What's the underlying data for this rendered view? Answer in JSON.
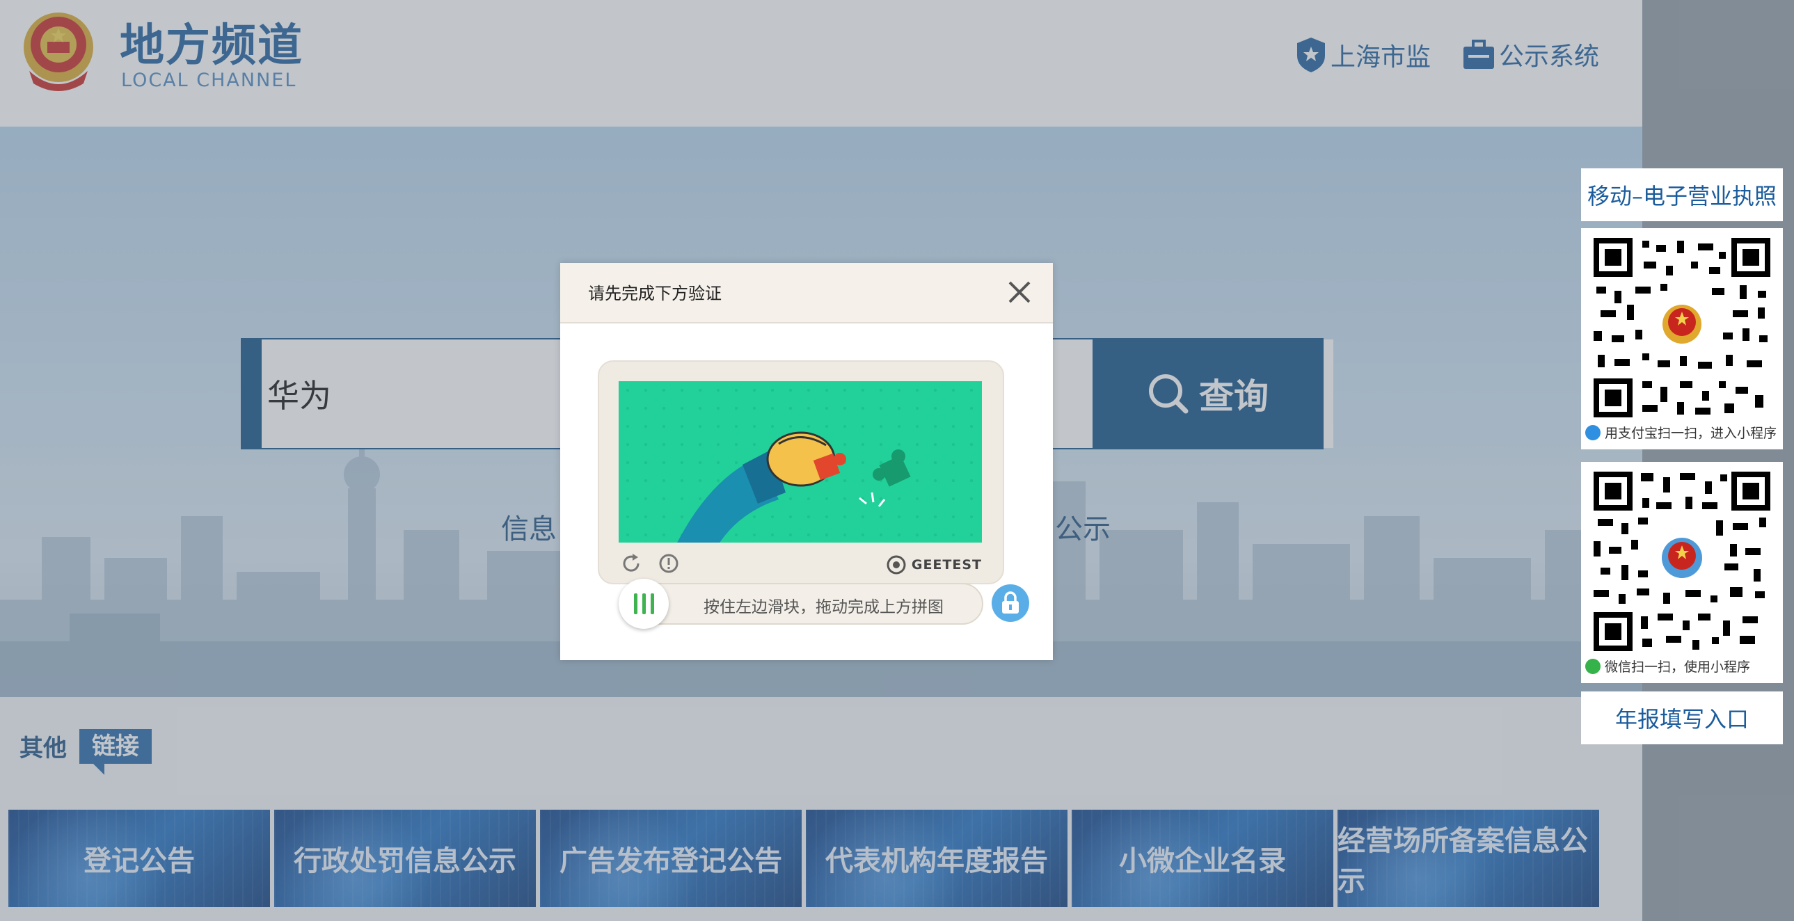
{
  "header": {
    "brand_title": "地方频道",
    "brand_subtitle": "LOCAL CHANNEL",
    "links": [
      {
        "label": "上海市监",
        "icon": "shield-star-icon"
      },
      {
        "label": "公示系统",
        "icon": "briefcase-icon"
      }
    ]
  },
  "search": {
    "value": "华为",
    "button_label": "查询"
  },
  "hero": {
    "left_text": "信息",
    "right_text": "公示"
  },
  "other_links": {
    "label": "其他",
    "tag": "链接",
    "tiles": [
      "登记公告",
      "行政处罚信息公示",
      "广告发布登记公告",
      "代表机构年度报告",
      "小微企业名录",
      "经营场所备案信息公示"
    ]
  },
  "side_panel": {
    "top_link": "移动–电子营业执照",
    "qr_alipay_caption": "用支付宝扫一扫，进入小程序",
    "qr_wechat_caption": "微信扫一扫，使用小程序",
    "bottom_link": "年报填写入口"
  },
  "modal": {
    "title": "请先完成下方验证",
    "captcha_brand": "GEETEST",
    "slider_hint": "按住左边滑块，拖动完成上方拼图"
  },
  "colors": {
    "brand_blue": "#1b5c9c",
    "search_blue": "#0f4e86",
    "captcha_green": "#22d19a",
    "lock_blue": "#5aaee8"
  }
}
